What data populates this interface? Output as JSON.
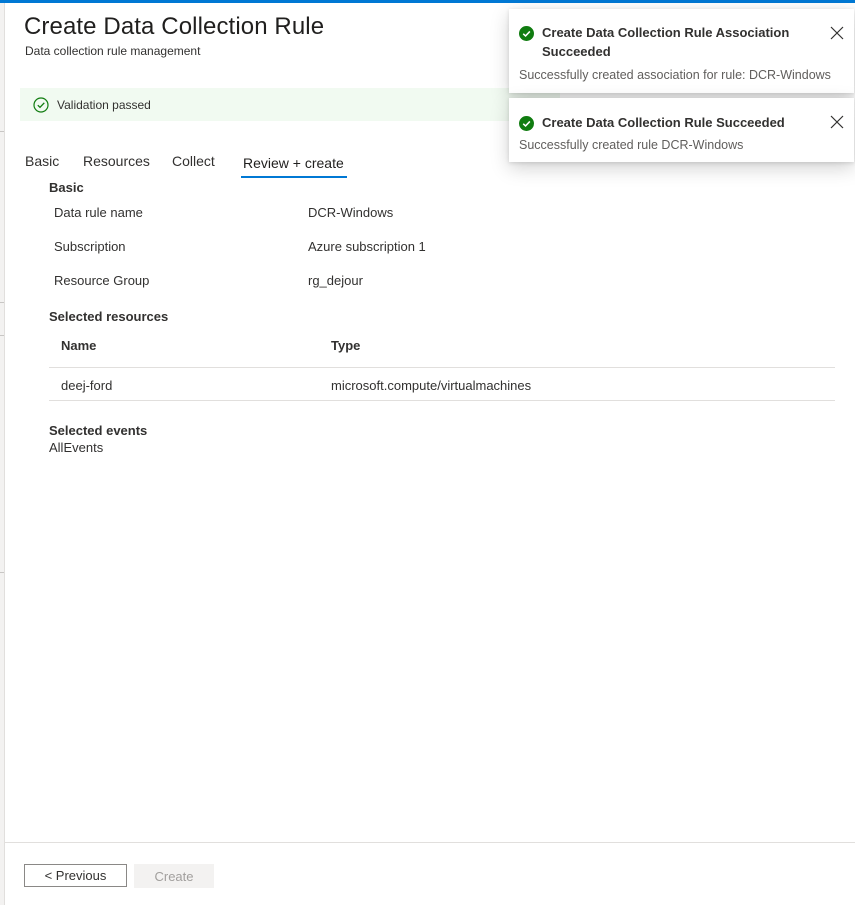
{
  "page": {
    "title": "Create Data Collection Rule",
    "subtitle": "Data collection rule management"
  },
  "validation": {
    "text": "Validation passed",
    "color": "#107c10"
  },
  "tabs": [
    {
      "label": "Basic"
    },
    {
      "label": "Resources"
    },
    {
      "label": "Collect"
    },
    {
      "label": "Review + create",
      "active": true
    }
  ],
  "basic": {
    "heading": "Basic",
    "rows": [
      {
        "label": "Data rule name",
        "value": "DCR-Windows"
      },
      {
        "label": "Subscription",
        "value": "Azure subscription 1"
      },
      {
        "label": "Resource Group",
        "value": "rg_dejour"
      }
    ]
  },
  "resources": {
    "heading": "Selected resources",
    "columns": [
      "Name",
      "Type"
    ],
    "rows": [
      {
        "name": "deej-ford",
        "type": "microsoft.compute/virtualmachines"
      }
    ]
  },
  "events": {
    "heading": "Selected events",
    "value": "AllEvents"
  },
  "footer": {
    "previous_label": "< Previous",
    "create_label": "Create"
  },
  "notifications": [
    {
      "title_line1": "Create Data Collection Rule Association",
      "title_line2": "Succeeded",
      "message": "Successfully created association for rule: DCR-Windows",
      "icon": "success-check-icon"
    },
    {
      "title_line1": "Create Data Collection Rule Succeeded",
      "message": "Successfully created rule DCR-Windows",
      "icon": "success-check-icon"
    }
  ],
  "colors": {
    "accent": "#0078d4",
    "success": "#107c10"
  }
}
